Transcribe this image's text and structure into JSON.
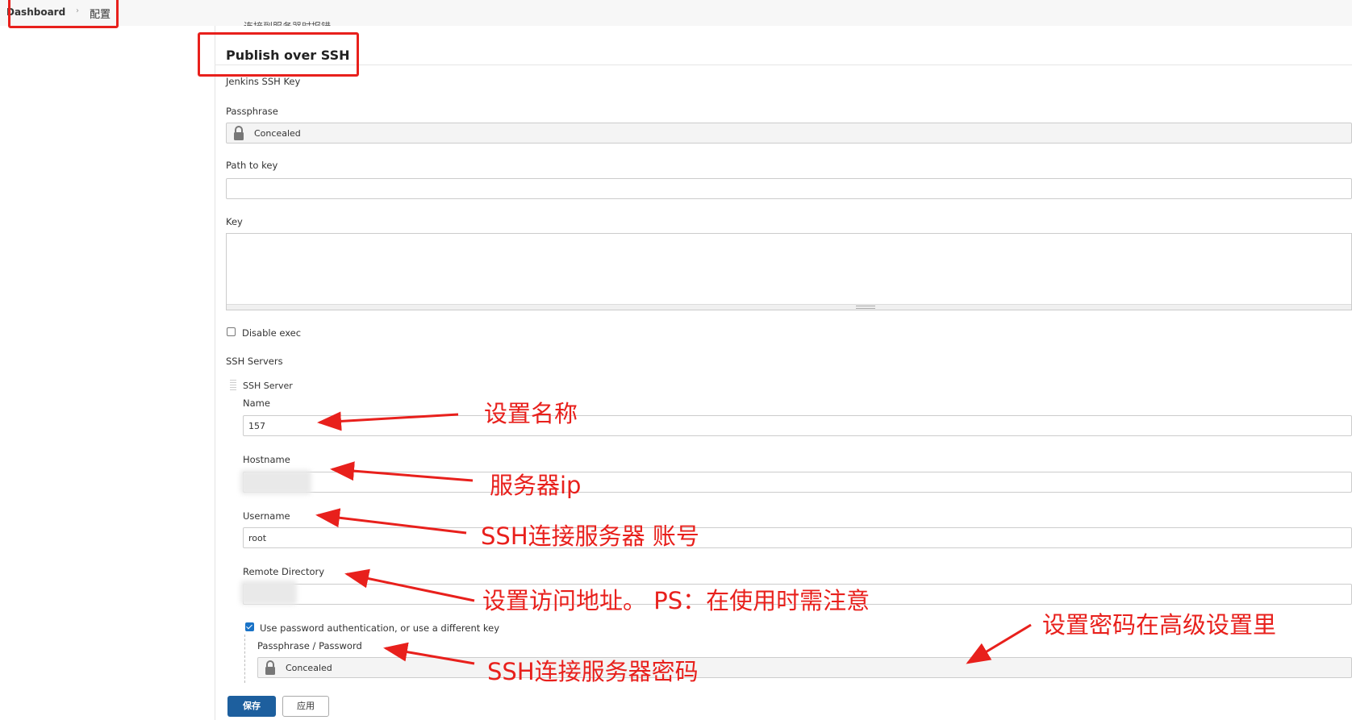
{
  "breadcrumb": {
    "home": "Dashboard",
    "separator": "›",
    "current": "配置"
  },
  "section": {
    "cut_text": "连接到服务器时报错",
    "title": "Publish over SSH"
  },
  "ssh_key": {
    "label": "Jenkins SSH Key",
    "passphrase_label": "Passphrase",
    "passphrase_value": "Concealed",
    "path_label": "Path to key",
    "path_value": "",
    "key_label": "Key",
    "key_value": ""
  },
  "disable_exec": {
    "label": "Disable exec",
    "checked": false
  },
  "servers": {
    "label": "SSH Servers",
    "server_label": "SSH Server",
    "name_label": "Name",
    "name_value": "157",
    "hostname_label": "Hostname",
    "username_label": "Username",
    "username_value": "root",
    "remote_dir_label": "Remote Directory",
    "use_password_label": "Use password authentication, or use a different key",
    "use_password_checked": true,
    "password_label": "Passphrase / Password",
    "password_value": "Concealed"
  },
  "buttons": {
    "save": "保存",
    "apply": "应用"
  },
  "annotations": {
    "name": "设置名称",
    "server_ip": "服务器ip",
    "account": "SSH连接服务器 账号",
    "remote_dir": "设置访问地址。 PS：在使用时需注意",
    "advanced": "设置密码在高级设置里",
    "password": "SSH连接服务器密码"
  },
  "colors": {
    "annotation_red": "#e8201c",
    "save_blue": "#1d5f9e",
    "checkbox_blue": "#1a73c7"
  }
}
